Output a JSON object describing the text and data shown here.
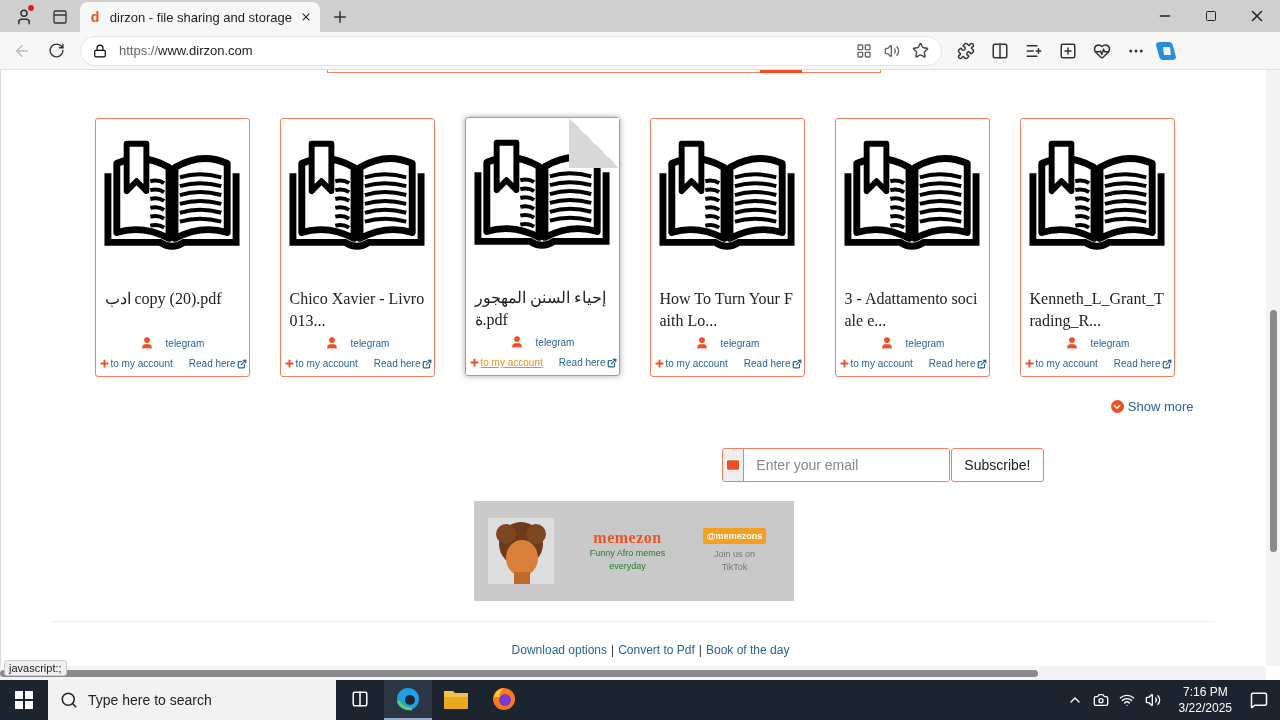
{
  "browser": {
    "tab": {
      "favicon": "d",
      "title": "dirzon - file sharing and storage"
    },
    "url_scheme": "https://",
    "url_host": "www.dirzon.com"
  },
  "files": [
    {
      "title": "ادب copy (20).pdf",
      "uploader": "telegram",
      "add_link": "to my account",
      "read_link": "Read here",
      "hovered": false
    },
    {
      "title": "Chico Xavier - Livro 013...",
      "uploader": "telegram",
      "add_link": "to my account",
      "read_link": "Read here",
      "hovered": false
    },
    {
      "title": "إحياء السنن المهجورة.pdf",
      "uploader": "telegram",
      "add_link": "to my account",
      "read_link": "Read here",
      "hovered": true
    },
    {
      "title": "How To Turn Your Faith Lo...",
      "uploader": "telegram",
      "add_link": "to my account",
      "read_link": "Read here",
      "hovered": false
    },
    {
      "title": "3 - Adattamento sociale e...",
      "uploader": "telegram",
      "add_link": "to my account",
      "read_link": "Read here",
      "hovered": false
    },
    {
      "title": "Kenneth_L_Grant_Trading_R...",
      "uploader": "telegram",
      "add_link": "to my account",
      "read_link": "Read here",
      "hovered": false
    }
  ],
  "show_more": "Show more",
  "subscribe": {
    "placeholder": "Enter your email",
    "button": "Subscribe!"
  },
  "ad": {
    "brand": "memezon",
    "tagline": "Funny Afro memes everyday",
    "handle": "@memezons",
    "cta": "Join us on TikTok"
  },
  "footer_links": [
    "Download options",
    "Convert to Pdf",
    "Book of the day"
  ],
  "footer_separators": [
    "|",
    "|"
  ],
  "status_url": "javascript:;",
  "taskbar": {
    "search_placeholder": "Type here to search",
    "time": "7:16 PM",
    "date": "3/22/2025"
  }
}
